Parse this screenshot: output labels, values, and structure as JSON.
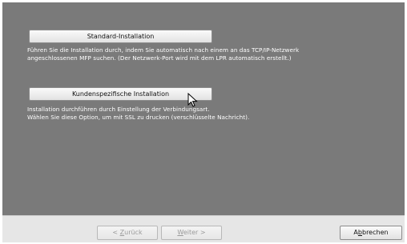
{
  "options": {
    "standard": {
      "label": "Standard-Installation",
      "description_line1": "Führen Sie die Installation durch, indem Sie automatisch nach einem an das TCP/IP-Netzwerk",
      "description_line2": "angeschlossenen MFP suchen. (Der Netzwerk-Port wird mit dem LPR automatisch erstellt.)"
    },
    "custom": {
      "label": "Kundenspezifische Installation",
      "description_line1": "Installation durchführen durch Einstellung der Verbindungsart.",
      "description_line2": "Wählen Sie diese Option, um mit SSL zu drucken (verschlüsselte Nachricht)."
    }
  },
  "footer": {
    "back": {
      "prefix": "< ",
      "accel": "Z",
      "rest": "urück"
    },
    "next": {
      "accel": "W",
      "rest": "eiter >"
    },
    "cancel": {
      "prefix": "A",
      "accel": "b",
      "rest": "brechen"
    }
  },
  "colors": {
    "panel": "#7a7a7a",
    "footer": "#e6e6e6",
    "description_text": "#ffffff"
  },
  "icons": {
    "cursor": "mouse-pointer-icon"
  }
}
